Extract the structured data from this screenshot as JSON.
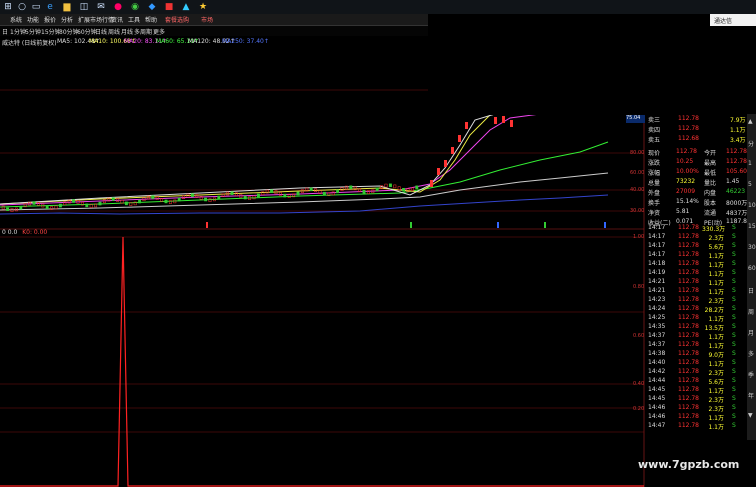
{
  "taskbar": {
    "icons": [
      "windows-logo-icon",
      "search-icon",
      "task-view-icon",
      "edge-browser-icon",
      "file-explorer-icon",
      "store-icon",
      "mail-icon",
      "app-icon",
      "chrome-icon",
      "app-icon-2",
      "office-icon",
      "app-icon-3",
      "app-icon-4"
    ],
    "right_label": "通达信"
  },
  "menu": {
    "items": [
      "系统",
      "功能",
      "报价",
      "分析",
      "扩展市场行情",
      "资讯",
      "工具",
      "帮助",
      "套餐选购",
      "市场"
    ]
  },
  "periods": {
    "items": [
      "1分钟",
      "5分钟",
      "15分钟",
      "30分钟",
      "60分钟",
      "日线",
      "周线",
      "月线",
      "多周期",
      "更多"
    ],
    "prefix": "日"
  },
  "ma_line": {
    "title": "威达特 (日线前复权)",
    "ma5": "MA5: 102.48↑",
    "ma10": "MA10: 100.68↑",
    "ma20": "MA20: 83.11↑",
    "ma60": "MA60: 65.10↑",
    "ma120": "MA120: 48.92↑",
    "ma250": "MA250: 37.40↑"
  },
  "price_axis": [
    "80.00",
    "60.00",
    "40.00",
    "30.00"
  ],
  "price_tag": "75.04",
  "quote": {
    "ask_labels": [
      "卖三",
      "卖四",
      "卖五"
    ],
    "ask_prices": [
      "112.78",
      "112.78",
      "112.68"
    ],
    "ask_vols": [
      "7.9万",
      "1.1万",
      "3.4万"
    ],
    "rows": [
      {
        "l1": "现价",
        "v1": "112.78",
        "l2": "今开",
        "v2": "112.78"
      },
      {
        "l1": "涨跌",
        "v1": "10.25",
        "l2": "最高",
        "v2": "112.78"
      },
      {
        "l1": "涨幅",
        "v1": "10.00%",
        "l2": "最低",
        "v2": "105.60"
      },
      {
        "l1": "总量",
        "v1": "73232",
        "l2": "量比",
        "v2": "1.45"
      },
      {
        "l1": "外盘",
        "v1": "27009",
        "l2": "内盘",
        "v2": "46223"
      },
      {
        "l1": "换手",
        "v1": "15.14%",
        "l2": "股本",
        "v2": "8000万"
      },
      {
        "l1": "净资",
        "v1": "5.81",
        "l2": "流通",
        "v2": "4837万"
      },
      {
        "l1": "收益(二)",
        "v1": "0.071",
        "l2": "PE(动)",
        "v2": "1187.8"
      }
    ]
  },
  "indicator": {
    "title": "0 0.0",
    "subtitle": "K0: 0.00",
    "axis": [
      "1.00",
      "0.80",
      "0.60",
      "0.40",
      "0.20"
    ]
  },
  "ticks": [
    {
      "t": "14:17",
      "p": "112.78",
      "v": "330.3万",
      "s": "S"
    },
    {
      "t": "14:17",
      "p": "112.78",
      "v": "2.3万",
      "s": "S"
    },
    {
      "t": "14:17",
      "p": "112.78",
      "v": "5.6万",
      "s": "S"
    },
    {
      "t": "14:17",
      "p": "112.78",
      "v": "1.1万",
      "s": "S"
    },
    {
      "t": "14:18",
      "p": "112.78",
      "v": "1.1万",
      "s": "S"
    },
    {
      "t": "14:19",
      "p": "112.78",
      "v": "1.1万",
      "s": "S"
    },
    {
      "t": "14:21",
      "p": "112.78",
      "v": "1.1万",
      "s": "S"
    },
    {
      "t": "14:21",
      "p": "112.78",
      "v": "1.1万",
      "s": "S"
    },
    {
      "t": "14:23",
      "p": "112.78",
      "v": "2.3万",
      "s": "S"
    },
    {
      "t": "14:24",
      "p": "112.78",
      "v": "28.2万",
      "s": "S"
    },
    {
      "t": "14:25",
      "p": "112.78",
      "v": "1.1万",
      "s": "S"
    },
    {
      "t": "14:35",
      "p": "112.78",
      "v": "13.5万",
      "s": "S"
    },
    {
      "t": "14:37",
      "p": "112.78",
      "v": "1.1万",
      "s": "S"
    },
    {
      "t": "14:37",
      "p": "112.78",
      "v": "1.1万",
      "s": "S"
    },
    {
      "t": "14:38",
      "p": "112.78",
      "v": "9.0万",
      "s": "S"
    },
    {
      "t": "14:40",
      "p": "112.78",
      "v": "1.1万",
      "s": "S"
    },
    {
      "t": "14:42",
      "p": "112.78",
      "v": "2.3万",
      "s": "S"
    },
    {
      "t": "14:44",
      "p": "112.78",
      "v": "5.6万",
      "s": "S"
    },
    {
      "t": "14:45",
      "p": "112.78",
      "v": "1.1万",
      "s": "S"
    },
    {
      "t": "14:45",
      "p": "112.78",
      "v": "2.3万",
      "s": "S"
    },
    {
      "t": "14:46",
      "p": "112.78",
      "v": "2.3万",
      "s": "S"
    },
    {
      "t": "14:46",
      "p": "112.78",
      "v": "1.1万",
      "s": "S"
    },
    {
      "t": "14:47",
      "p": "112.78",
      "v": "1.1万",
      "s": "S"
    }
  ],
  "scroll_glyphs": [
    "▲",
    "分",
    "1",
    "5",
    "10",
    "15",
    "30",
    "60",
    "日",
    "周",
    "月",
    "多",
    "季",
    "年",
    "▼"
  ],
  "watermark": "www.7gpzb.com",
  "colors": {
    "up": "#ff3333",
    "down": "#33cc33",
    "yellow": "#ffff33",
    "grid": "#7a1010"
  }
}
